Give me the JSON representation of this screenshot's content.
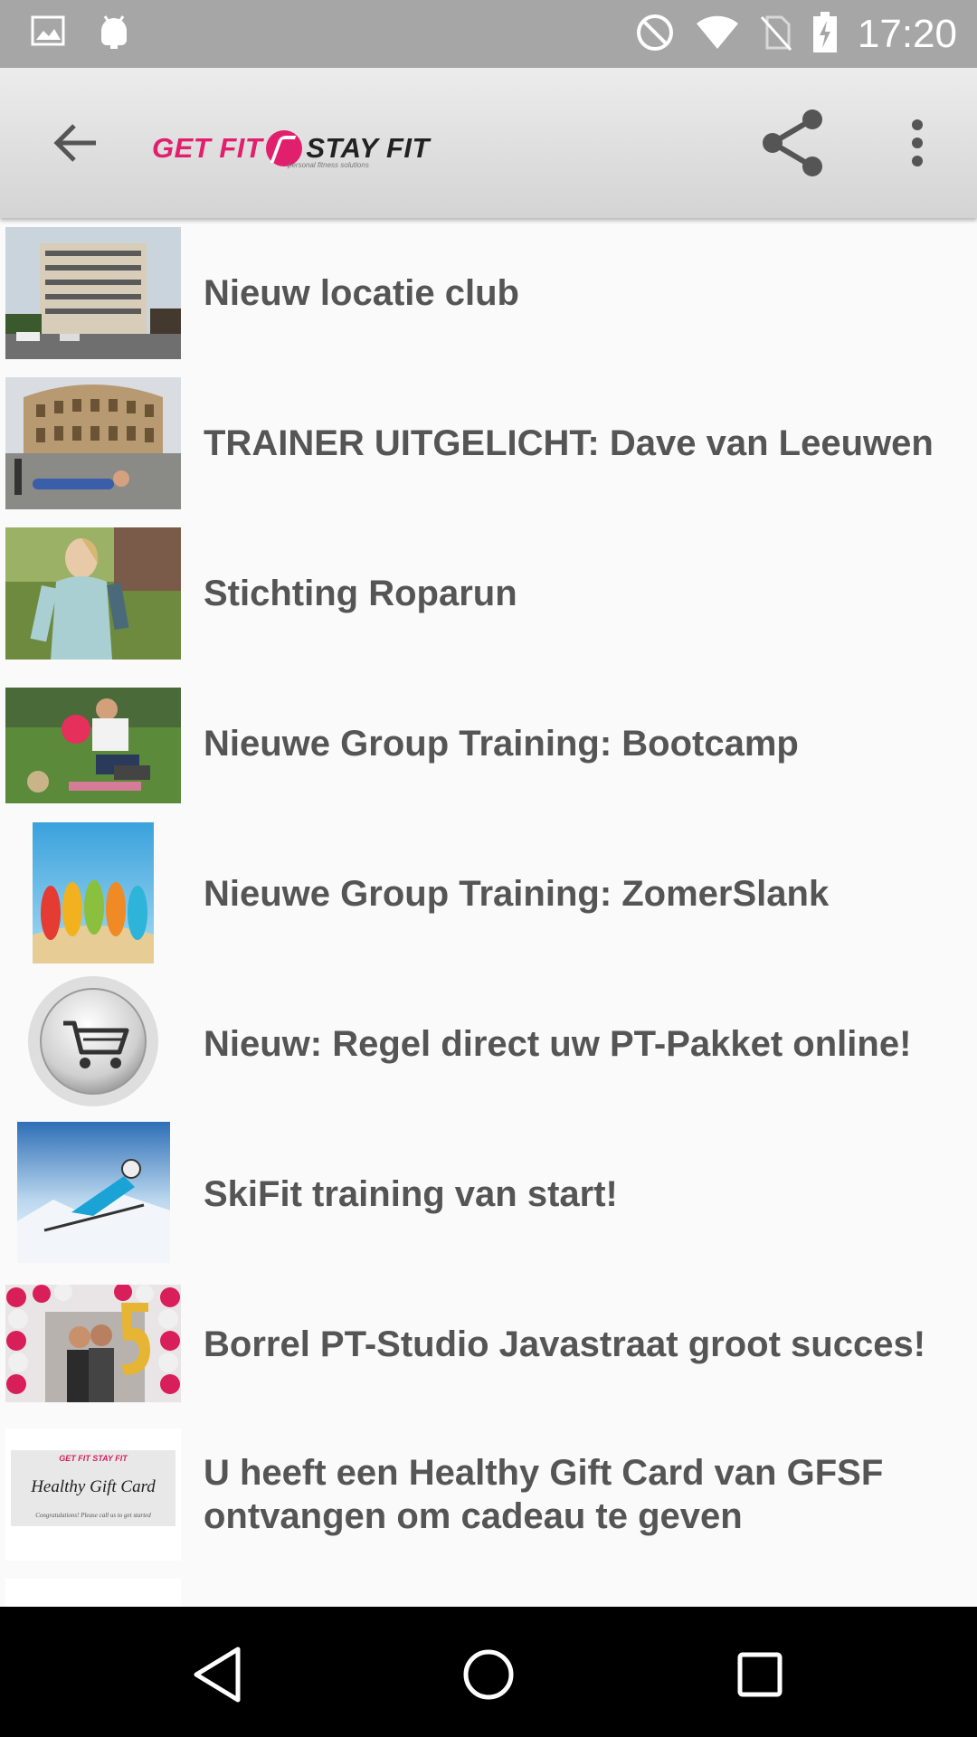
{
  "status_bar": {
    "time": "17:20",
    "icons": [
      "image-icon",
      "android-debug-icon",
      "do-not-disturb-icon",
      "wifi-icon",
      "no-sim-icon",
      "battery-charging-icon"
    ]
  },
  "toolbar": {
    "back_icon": "arrow-back-icon",
    "logo": {
      "part1": "GET FIT",
      "part2": "STAY FIT",
      "tagline": "personal fitness solutions"
    },
    "share_icon": "share-icon",
    "more_icon": "more-vert-icon"
  },
  "news": {
    "items": [
      {
        "title": "Nieuw locatie club",
        "thumb": "building-photo"
      },
      {
        "title": "TRAINER UITGELICHT: Dave van Leeuwen",
        "thumb": "colosseum-pushup-photo"
      },
      {
        "title": "Stichting Roparun",
        "thumb": "runner-woman-photo"
      },
      {
        "title": "Nieuwe Group Training: Bootcamp",
        "thumb": "bootcamp-photo"
      },
      {
        "title": "Nieuwe Group Training: ZomerSlank",
        "thumb": "flipflops-beach-photo"
      },
      {
        "title": "Nieuw: Regel direct uw PT-Pakket online!",
        "thumb": "shopping-cart-icon"
      },
      {
        "title": "SkiFit training van start!",
        "thumb": "skier-photo"
      },
      {
        "title": "Borrel PT-Studio Javastraat groot succes!",
        "thumb": "balloons-party-photo"
      },
      {
        "title": "U heeft een Healthy Gift Card van GFSF ontvangen om cadeau te geven",
        "thumb": "gift-card-image"
      }
    ],
    "gift_card": {
      "brand": "GET FIT STAY FIT",
      "name": "Healthy Gift Card",
      "footer": "Congratulations! Please call us to get started"
    }
  },
  "nav_bar": {
    "icons": [
      "nav-back-icon",
      "nav-home-icon",
      "nav-recents-icon"
    ]
  }
}
